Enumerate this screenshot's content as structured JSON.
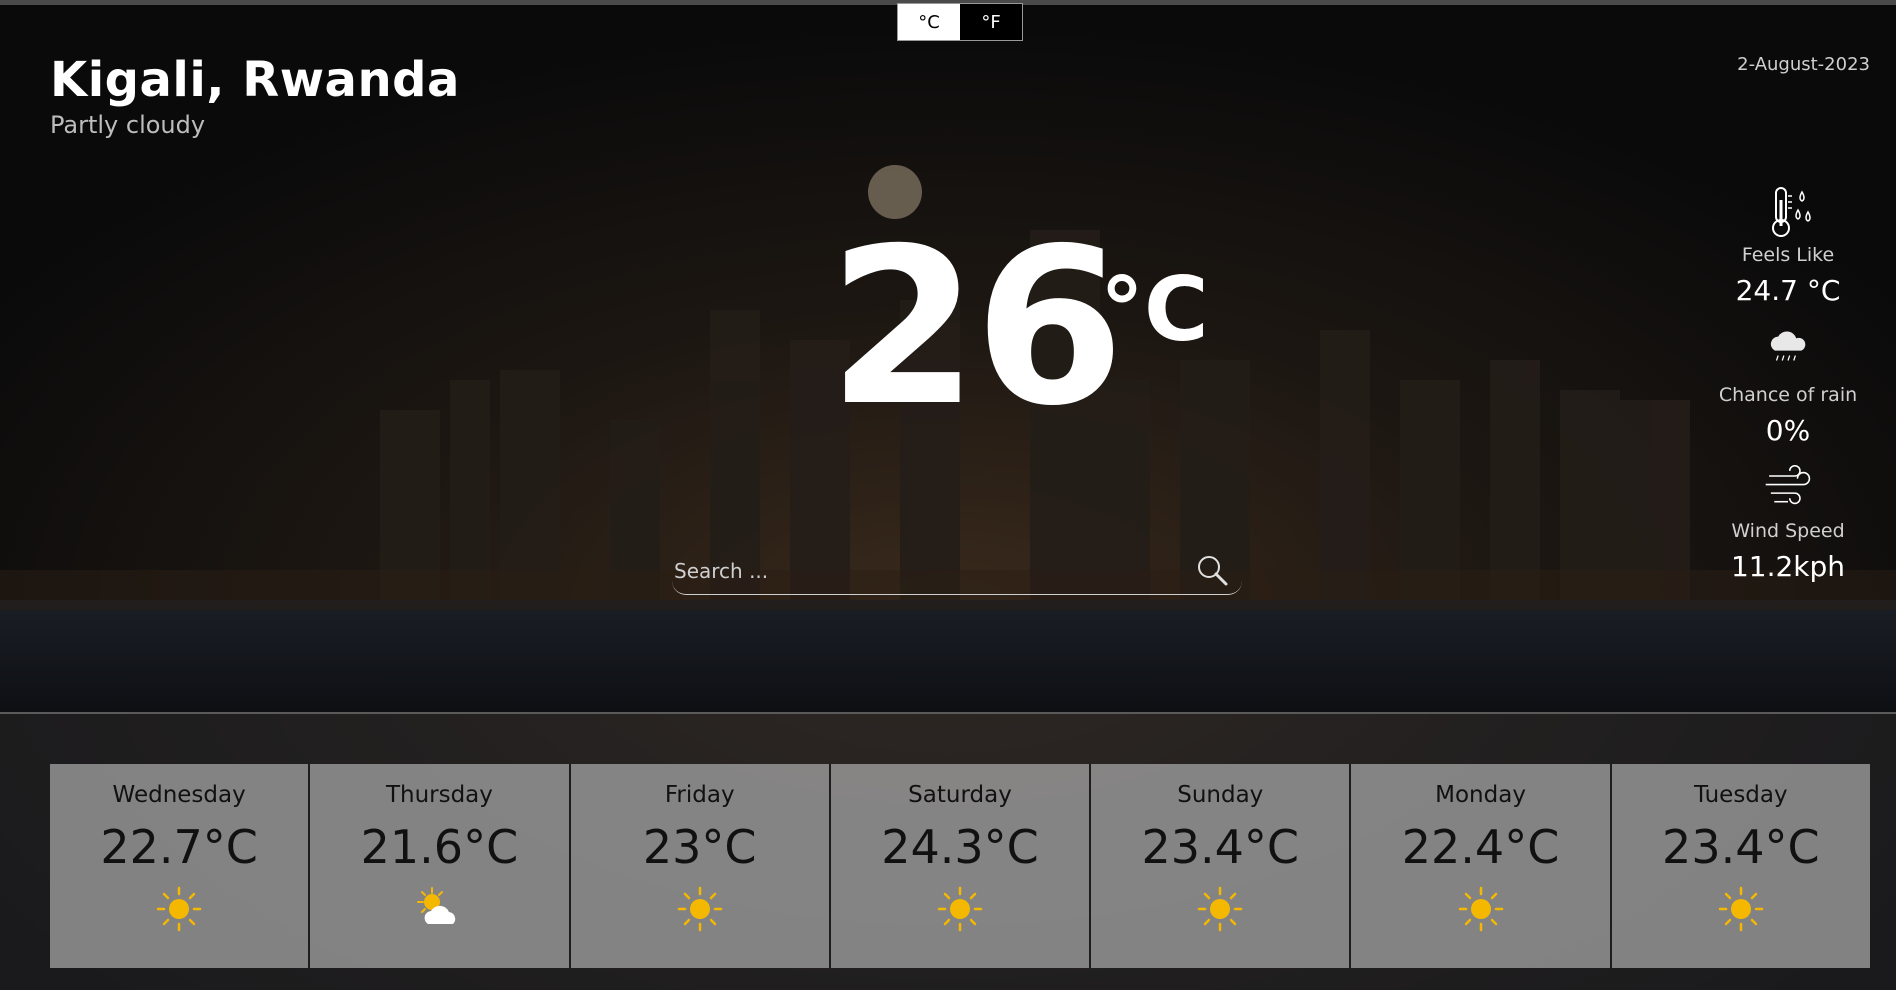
{
  "header": {
    "city": "Kigali, Rwanda",
    "condition": "Partly cloudy",
    "date": "2-August-2023"
  },
  "unit_toggle": {
    "celsius_label": "°C",
    "fahrenheit_label": "°F",
    "selected": "°C"
  },
  "current": {
    "temperature": "26",
    "unit": "°C"
  },
  "search": {
    "placeholder": "Search ..."
  },
  "details": {
    "feels_like": {
      "label": "Feels Like",
      "value": "24.7 °C",
      "icon": "thermometer-icon"
    },
    "chance_of_rain": {
      "label": "Chance of rain",
      "value": "0%",
      "icon": "rain-cloud-icon"
    },
    "wind_speed": {
      "label": "Wind Speed",
      "value": "11.2kph",
      "icon": "wind-icon"
    }
  },
  "forecast": [
    {
      "day": "Wednesday",
      "temp": "22.7°C",
      "icon": "sun-icon"
    },
    {
      "day": "Thursday",
      "temp": "21.6°C",
      "icon": "partly-cloudy-icon"
    },
    {
      "day": "Friday",
      "temp": "23°C",
      "icon": "sun-icon"
    },
    {
      "day": "Saturday",
      "temp": "24.3°C",
      "icon": "sun-icon"
    },
    {
      "day": "Sunday",
      "temp": "23.4°C",
      "icon": "sun-icon"
    },
    {
      "day": "Monday",
      "temp": "22.4°C",
      "icon": "sun-icon"
    },
    {
      "day": "Tuesday",
      "temp": "23.4°C",
      "icon": "sun-icon"
    }
  ],
  "colors": {
    "accent_sun": "#f5b800",
    "card_bg": "#aaaaaa",
    "background": "#0b0b0c"
  }
}
